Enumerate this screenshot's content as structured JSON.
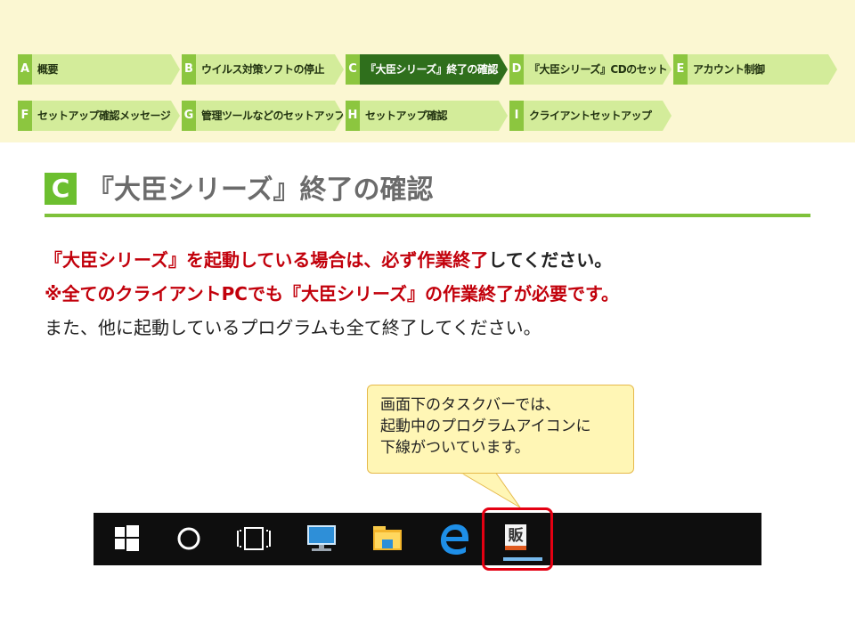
{
  "nav": {
    "steps": [
      {
        "letter": "A",
        "label": "概要"
      },
      {
        "letter": "B",
        "label": "ウイルス対策ソフトの停止"
      },
      {
        "letter": "C",
        "label": "『大臣シリーズ』終了の確認"
      },
      {
        "letter": "D",
        "label": "『大臣シリーズ』CDのセット"
      },
      {
        "letter": "E",
        "label": "アカウント制御"
      },
      {
        "letter": "F",
        "label": "セットアップ確認メッセージ"
      },
      {
        "letter": "G",
        "label": "管理ツールなどのセットアップ"
      },
      {
        "letter": "H",
        "label": "セットアップ確認"
      },
      {
        "letter": "I",
        "label": "クライアントセットアップ"
      }
    ],
    "active_letter": "C"
  },
  "section": {
    "badge": "C",
    "title": "『大臣シリーズ』終了の確認"
  },
  "body": {
    "line1_red": "『大臣シリーズ』を起動している場合は、必ず作業終了",
    "line1_black": "してください。",
    "line2": "※全てのクライアントPCでも『大臣シリーズ』の作業終了が必要です。",
    "line3": "また、他に起動しているプログラムも全て終了してください。"
  },
  "callout": {
    "line1": "画面下のタスクバーでは、",
    "line2": "起動中のプログラムアイコンに",
    "line3": "下線がついています。"
  },
  "taskbar": {
    "icons": [
      "windows-start-icon",
      "cortana-circle-icon",
      "task-view-icon",
      "this-pc-monitor-icon",
      "file-explorer-icon",
      "edge-icon",
      "daijin-app-icon"
    ],
    "app_icon_char": "販",
    "running_app": "daijin-app-icon"
  },
  "colors": {
    "accent_green": "#7ec13a",
    "active_step": "#2f6f1c",
    "emphasis_red": "#c2000b",
    "highlight_red": "#e40012",
    "callout_fill": "#fff6b5"
  }
}
